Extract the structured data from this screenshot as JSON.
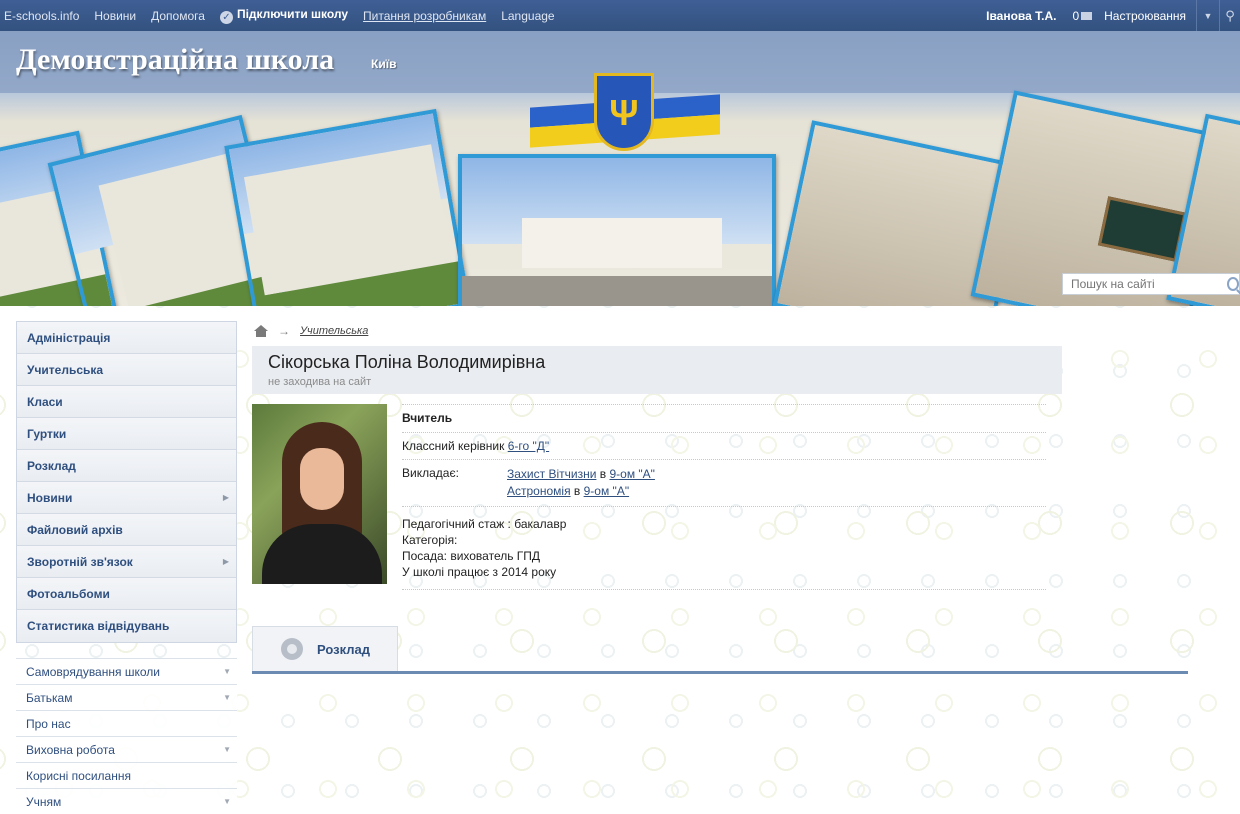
{
  "topbar": {
    "links": [
      "E-schools.info",
      "Новини",
      "Допомога"
    ],
    "connect_label": "Підключити школу",
    "dev_label": "Питання розробникам",
    "language_label": "Language",
    "user_name": "Іванова Т.А.",
    "messages_count": "0",
    "settings_label": "Настроювання"
  },
  "header": {
    "school_title": "Демонстраційна школа",
    "city": "Київ"
  },
  "search": {
    "placeholder": "Пошук на сайті"
  },
  "sidebar": {
    "menu": [
      {
        "label": "Адміністрація",
        "has_arrow": false
      },
      {
        "label": "Учительська",
        "has_arrow": false
      },
      {
        "label": "Класи",
        "has_arrow": false
      },
      {
        "label": "Гуртки",
        "has_arrow": false
      },
      {
        "label": "Розклад",
        "has_arrow": false
      },
      {
        "label": "Новини",
        "has_arrow": true
      },
      {
        "label": "Файловий архів",
        "has_arrow": false
      },
      {
        "label": "Зворотній зв'язок",
        "has_arrow": true
      },
      {
        "label": "Фотоальбоми",
        "has_arrow": false
      },
      {
        "label": "Статистика відвідувань",
        "has_arrow": false
      }
    ],
    "submenu": [
      {
        "label": "Самоврядування школи",
        "has_arrow": true
      },
      {
        "label": "Батькам",
        "has_arrow": true
      },
      {
        "label": "Про нас",
        "has_arrow": false
      },
      {
        "label": "Виховна робота",
        "has_arrow": true
      },
      {
        "label": "Корисні посилання",
        "has_arrow": false
      },
      {
        "label": "Учням",
        "has_arrow": true
      }
    ]
  },
  "breadcrumb": {
    "link": "Учительська"
  },
  "profile": {
    "name": "Сікорська Поліна Володимирівна",
    "status": "не заходива на сайт",
    "role": "Вчитель",
    "class_teacher_label": "Классний керівник",
    "class_teacher_link": "6-го \"Д\"",
    "teaches_label": "Викладає:",
    "subjects": [
      {
        "subject": "Захист Вітчизни",
        "in": "в",
        "class": "9-ом \"А\""
      },
      {
        "subject": "Астрономія",
        "in": "в",
        "class": "9-ом \"А\""
      }
    ],
    "info": [
      "Педагогічний стаж : бакалавр",
      "Категорія:",
      "Посада: вихователь ГПД",
      "У школі працює з 2014 року"
    ]
  },
  "tabs": [
    {
      "label": "Розклад"
    }
  ],
  "colors": {
    "topbar": "#3f5f96",
    "accent": "#2f4f7f",
    "photo_border": "#2f9ad6",
    "tab_line": "#6b8bb3"
  },
  "icons": [
    "check-icon",
    "mail-icon",
    "chevron-down-icon",
    "run-icon",
    "search-icon",
    "home-icon",
    "arrow-right-icon",
    "bell-icon"
  ]
}
